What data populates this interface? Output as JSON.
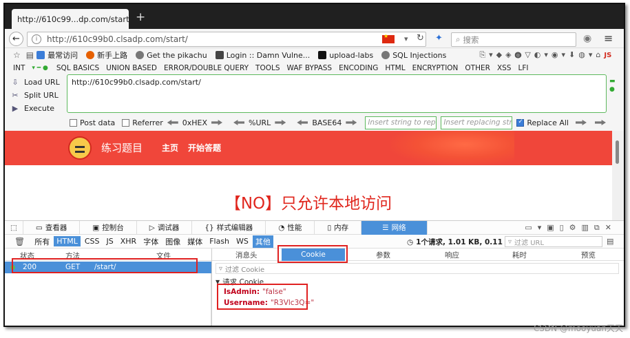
{
  "tab": {
    "title": "http://610c99...dp.com/start/",
    "close": "×",
    "new": "+"
  },
  "nav": {
    "url": "http://610c99b0.clsadp.com/start/",
    "search_placeholder": "搜索"
  },
  "bookmarks": [
    "最常访问",
    "新手上路",
    "Get the pikachu",
    "Login :: Damn Vulne...",
    "upload-labs",
    "SQL Injections"
  ],
  "hackbar": {
    "menu": [
      "INT",
      "SQL BASICS",
      "UNION BASED",
      "ERROR/DOUBLE QUERY",
      "TOOLS",
      "WAF BYPASS",
      "ENCODING",
      "HTML",
      "ENCRYPTION",
      "OTHER",
      "XSS",
      "LFI"
    ],
    "actions": [
      "Load URL",
      "Split URL",
      "Execute"
    ],
    "url_value": "http://610c99b0.clsadp.com/start/",
    "post_data": "Post data",
    "referrer": "Referrer",
    "hex": "0xHEX",
    "urlenc": "%URL",
    "base64": "BASE64",
    "insert_placeholder": "Insert string to replace",
    "replace_placeholder": "Insert replacing string",
    "replace_all": "Replace All"
  },
  "page": {
    "site_title": "练习题目",
    "nav_home": "主页",
    "nav_start": "开始答题",
    "message": "【NO】只允许本地访问"
  },
  "devtools": {
    "tabs": [
      "查看器",
      "控制台",
      "调试器",
      "样式编辑器",
      "性能",
      "内存",
      "网络"
    ],
    "filters": [
      "所有",
      "HTML",
      "CSS",
      "JS",
      "XHR",
      "字体",
      "图像",
      "媒体",
      "Flash",
      "WS",
      "其他"
    ],
    "summary": "1个请求, 1.01 KB, 0.11 秒",
    "url_filter_placeholder": "过滤 URL",
    "columns": {
      "status": "状态",
      "method": "方法",
      "file": "文件"
    },
    "request": {
      "status": "200",
      "method": "GET",
      "file": "/start/"
    },
    "detail_tabs": [
      "消息头",
      "Cookie",
      "参数",
      "响应",
      "耗时",
      "预览"
    ],
    "cookie_filter": "过滤 Cookie",
    "request_cookie_label": "请求 Cookie",
    "cookies": [
      {
        "key": "IsAdmin:",
        "value": "\"false\""
      },
      {
        "key": "Username:",
        "value": "\"R3Vlc3Q=\""
      }
    ]
  },
  "watermark": "CSDN @mooyuan天天",
  "colors": {
    "page_header": "#f0463a",
    "selection": "#4a90d9",
    "highlight_box": "#e02020",
    "message": "#e0261d"
  }
}
